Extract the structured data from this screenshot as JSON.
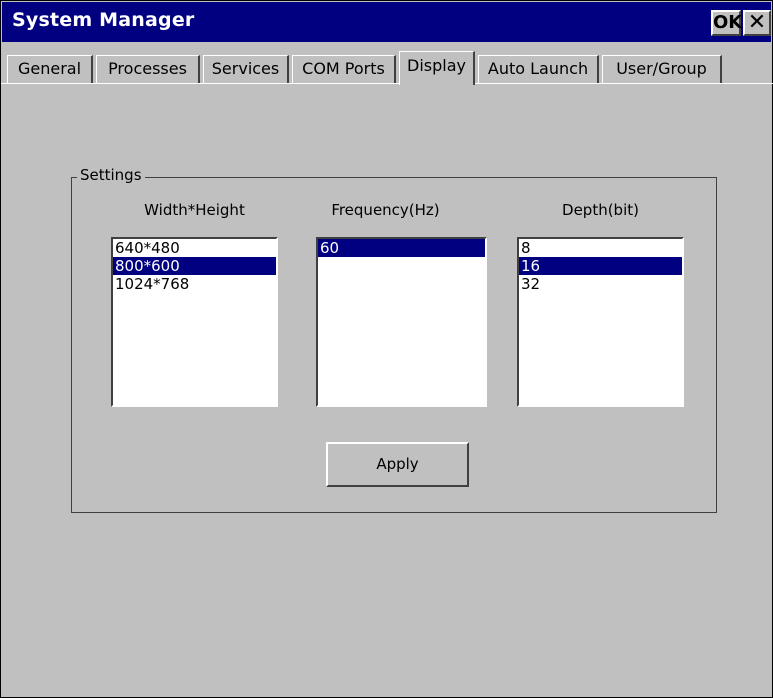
{
  "window": {
    "title": "System Manager",
    "ok_label": "OK",
    "close_symbol": "✕"
  },
  "tabs": [
    {
      "label": "General",
      "active": false
    },
    {
      "label": "Processes",
      "active": false
    },
    {
      "label": "Services",
      "active": false
    },
    {
      "label": "COM Ports",
      "active": false
    },
    {
      "label": "Display",
      "active": true
    },
    {
      "label": "Auto Launch",
      "active": false
    },
    {
      "label": "User/Group",
      "active": false
    }
  ],
  "settings": {
    "group_label": "Settings",
    "resolution": {
      "label": "Width*Height",
      "options": [
        "640*480",
        "800*600",
        "1024*768"
      ],
      "selected": "800*600"
    },
    "frequency": {
      "label": "Frequency(Hz)",
      "options": [
        "60"
      ],
      "selected": "60"
    },
    "depth": {
      "label": "Depth(bit)",
      "options": [
        "8",
        "16",
        "32"
      ],
      "selected": "16"
    },
    "apply_label": "Apply"
  },
  "colors": {
    "title_bar": "#000080",
    "selection": "#000080",
    "face": "#c0c0c0"
  }
}
